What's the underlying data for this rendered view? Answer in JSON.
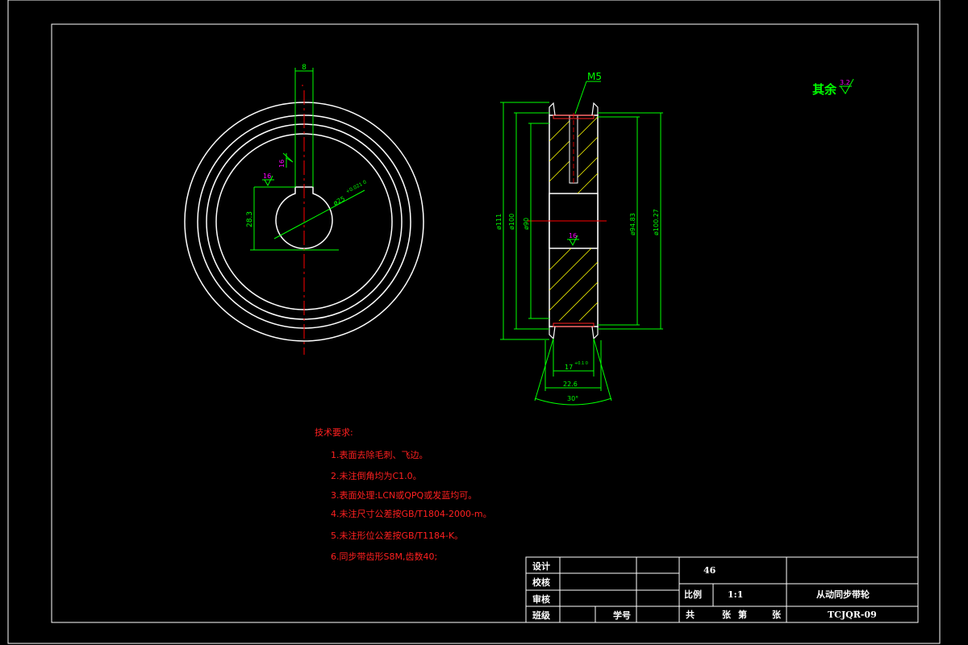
{
  "drawing": {
    "title": "从动同步带轮",
    "code": "TCJQR-09",
    "material": "46",
    "scale_label": "比例",
    "scale_value": "1:1",
    "sheet": {
      "total": "共",
      "zhang1": "张",
      "di": "第",
      "zhang2": "张"
    },
    "roles": {
      "design": "设计",
      "check": "校核",
      "review": "审核",
      "class": "班级",
      "student_no": "学号"
    }
  },
  "roughness_note": {
    "text": "其余",
    "value": "3.2"
  },
  "tech_requirements": {
    "heading": "技术要求:",
    "items": [
      "1.表面去除毛刺、飞边。",
      "2.未注倒角均为C1.0。",
      "3.表面处理:LCN或QPQ或发蓝均可。",
      "4.未注尺寸公差按GB/T1804-2000-m。",
      "5.未注形位公差按GB/T1184-K。",
      "6.同步带齿形S8M,齿数40;"
    ]
  },
  "front_view": {
    "dim_keyway": "8",
    "dim_height": "28.3",
    "dim_bore": "ø25",
    "bore_tol": "+0.021 0",
    "rough_1": "16",
    "rough_2": "16"
  },
  "side_view": {
    "thread": "M5",
    "d1": "ø111",
    "d2": "ø100",
    "d3": "ø90",
    "d4": "ø94.83",
    "d5": "ø100.27",
    "w_inner": "17",
    "w_inner_tol": "+0.1 0",
    "w_total": "22.6",
    "angle": "30°",
    "rough_bore": "16"
  },
  "colors": {
    "line": "#ffffff",
    "dim": "#00ff00",
    "center": "#ff0000",
    "text_red": "#ff2020",
    "magenta": "#ff00ff",
    "hatch": "#ffff00"
  }
}
